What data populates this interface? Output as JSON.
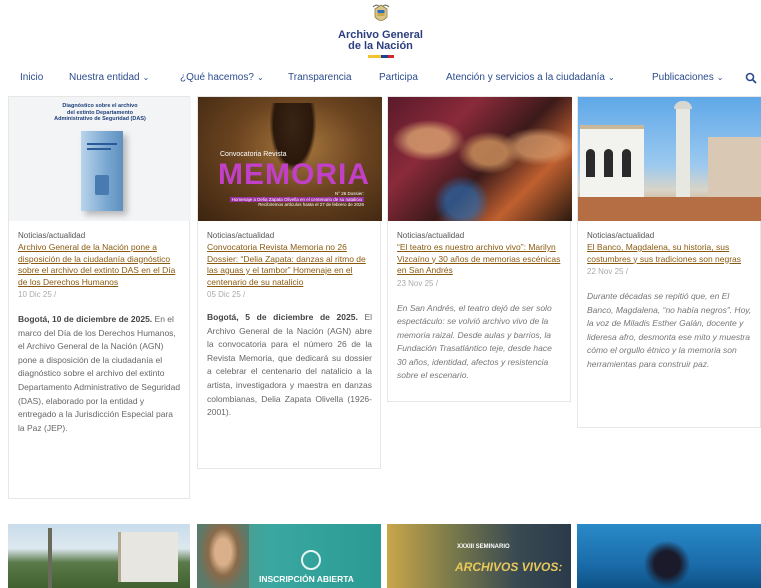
{
  "header": {
    "logo_line1": "Archivo General",
    "logo_line2": "de la Nación",
    "flag_colors": [
      "#f4c430",
      "#1f3f99",
      "#d62828"
    ]
  },
  "nav": {
    "items": [
      {
        "label": "Inicio",
        "dropdown": false
      },
      {
        "label": "Nuestra entidad",
        "dropdown": true
      },
      {
        "label": "¿Qué hacemos?",
        "dropdown": true
      },
      {
        "label": "Transparencia",
        "dropdown": false
      },
      {
        "label": "Participa",
        "dropdown": false
      },
      {
        "label": "Atención y servicios a la ciudadanía",
        "dropdown": true
      },
      {
        "label": "Publicaciones",
        "dropdown": true
      }
    ],
    "chevron": "⌄",
    "search_icon": "search-icon"
  },
  "cards": [
    {
      "image_caption_lines": [
        "Diagnóstico sobre el archivo",
        "del extinto Departamento",
        "Administrativo de Seguridad (DAS)"
      ],
      "category": "Noticias/actualidad",
      "title": "Archivo General de la Nación pone a disposición de la ciudadanía diagnóstico sobre el archivo del extinto DAS en el Día de los Derechos Humanos",
      "date": "10 Dic 25 /",
      "lead": "Bogotá, 10 de diciembre de 2025.",
      "excerpt": " En el marco del Día de los Derechos Humanos, el Archivo General de la Nación (AGN) pone a disposición de la ciudadanía el diagnóstico sobre el archivo del extinto Departamento Administrativo de Seguridad (DAS), elaborado por la entidad y entregado a la Jurisdicción Especial para la Paz (JEP)."
    },
    {
      "image_text": {
        "kicker": "Convocatoria Revista",
        "big": "MEMORIA",
        "issue": "N° 26 Dossier:",
        "sub1": "Homenaje a Delia Zapata Olivella en el centenario de su natalicio",
        "sub2": "Recibiremos artículos hasta el 27 de febrero de 2026"
      },
      "category": "Noticias/actualidad",
      "title": "Convocatoria Revista Memoria no 26 Dossier: “Delia Zapata: danzas al ritmo de las aguas y el tambor” Homenaje en el centenario de su natalicio",
      "date": "05 Dic 25 /",
      "lead": "Bogotá, 5 de diciembre de 2025.",
      "excerpt": " El Archivo General de la Nación (AGN) abre la convocatoria para el número 26 de la Revista Memoria, que dedicará su dossier a celebrar el centenario del natalicio a la artista, investigadora y maestra en danzas colombianas, Delia Zapata Olivella (1926-2001)."
    },
    {
      "category": "Noticias/actualidad",
      "title": "“El teatro es nuestro archivo vivo”: Marilyn Vizcaíno y 30 años de memorias escénicas en San Andrés",
      "date": "23 Nov 25 /",
      "excerpt": "En San Andrés, el teatro dejó de ser solo espectáculo: se volvió archivo vivo de la memoria raizal. Desde aulas y barrios, la Fundación Trasatlántico teje, desde hace 30 años, identidad, afectos y resistencia sobre el escenario."
    },
    {
      "category": "Noticias/actualidad",
      "title": "El Banco, Magdalena, su historia, sus costumbres y sus tradiciones son negras",
      "date": "22 Nov 25 /",
      "excerpt": "Durante décadas se repitió que, en El Banco, Magdalena, “no había negros”. Hoy, la voz de Miladis Esther Galán, docente y lideresa afro, desmonta ese mito y muestra cómo el orgullo étnico y la memoria son herramientas para construir paz."
    }
  ],
  "bottom_row": {
    "card2_text": "INSCRIPCIÓN ABIERTA",
    "card3_line1": "XXXIII SEMINARIO",
    "card3_line2": "ARCHIVOS VIVOS:"
  }
}
